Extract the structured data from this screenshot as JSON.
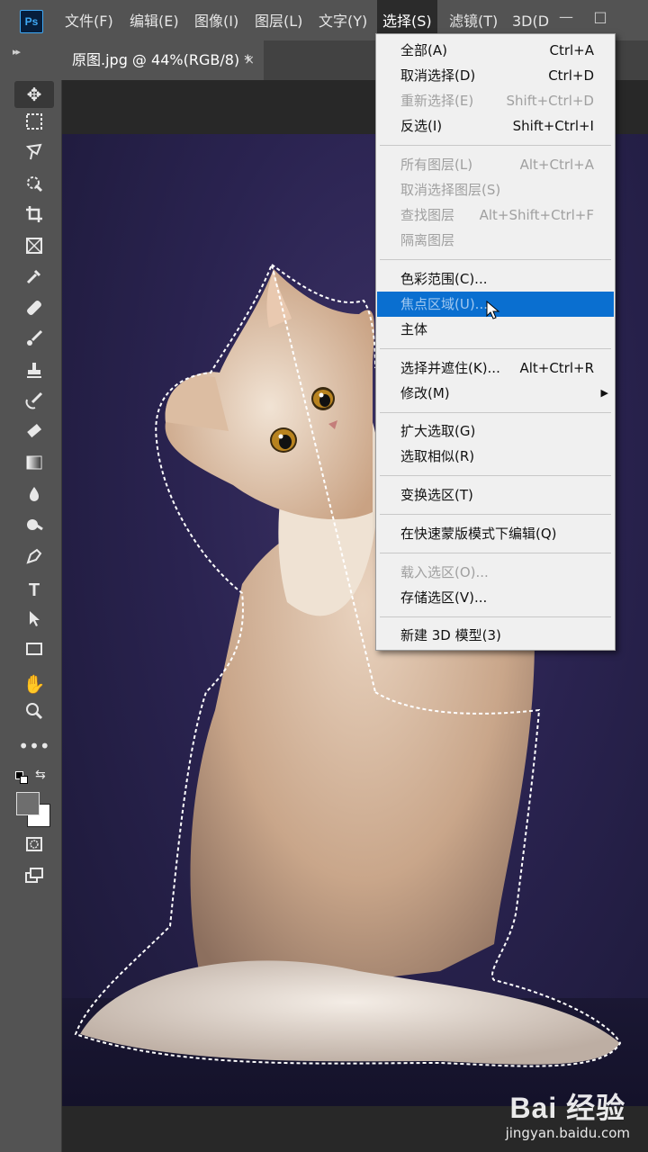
{
  "menubar": {
    "logo": "Ps",
    "items": [
      "文件(F)",
      "编辑(E)",
      "图像(I)",
      "图层(L)",
      "文字(Y)",
      "选择(S)",
      "滤镜(T)",
      "3D(D"
    ],
    "active_index": 5,
    "window_controls": [
      "—",
      "□"
    ]
  },
  "document_tab": {
    "title": "原图.jpg @ 44%(RGB/8) *",
    "close": "×"
  },
  "toolbar": {
    "tools": [
      "move-tool",
      "marquee-tool",
      "lasso-tool",
      "quick-select-tool",
      "crop-tool",
      "frame-tool",
      "eyedropper-tool",
      "healing-brush-tool",
      "brush-tool",
      "clone-stamp-tool",
      "history-brush-tool",
      "eraser-tool",
      "gradient-tool",
      "blur-tool",
      "dodge-tool",
      "pen-tool",
      "type-tool",
      "path-select-tool",
      "rectangle-tool",
      "hand-tool",
      "zoom-tool",
      "more-tools",
      "swap-colors",
      "color-swatches",
      "quick-mask",
      "screen-mode"
    ],
    "colors": {
      "foreground": "#6e6e6e",
      "background": "#ffffff"
    }
  },
  "select_menu": {
    "items": [
      {
        "label": "全部(A)",
        "shortcut": "Ctrl+A",
        "enabled": true
      },
      {
        "label": "取消选择(D)",
        "shortcut": "Ctrl+D",
        "enabled": true
      },
      {
        "label": "重新选择(E)",
        "shortcut": "Shift+Ctrl+D",
        "enabled": false
      },
      {
        "label": "反选(I)",
        "shortcut": "Shift+Ctrl+I",
        "enabled": true
      },
      {
        "label": "所有图层(L)",
        "shortcut": "Alt+Ctrl+A",
        "enabled": false
      },
      {
        "label": "取消选择图层(S)",
        "shortcut": "",
        "enabled": false
      },
      {
        "label": "查找图层",
        "shortcut": "Alt+Shift+Ctrl+F",
        "enabled": false
      },
      {
        "label": "隔离图层",
        "shortcut": "",
        "enabled": false
      },
      {
        "label": "色彩范围(C)...",
        "shortcut": "",
        "enabled": true
      },
      {
        "label": "焦点区域(U)...",
        "shortcut": "",
        "enabled": true,
        "highlighted": true
      },
      {
        "label": "主体",
        "shortcut": "",
        "enabled": true
      },
      {
        "label": "选择并遮住(K)...",
        "shortcut": "Alt+Ctrl+R",
        "enabled": true
      },
      {
        "label": "修改(M)",
        "shortcut": "",
        "enabled": true,
        "submenu": true
      },
      {
        "label": "扩大选取(G)",
        "shortcut": "",
        "enabled": true
      },
      {
        "label": "选取相似(R)",
        "shortcut": "",
        "enabled": true
      },
      {
        "label": "变换选区(T)",
        "shortcut": "",
        "enabled": true
      },
      {
        "label": "在快速蒙版模式下编辑(Q)",
        "shortcut": "",
        "enabled": true
      },
      {
        "label": "载入选区(O)...",
        "shortcut": "",
        "enabled": false
      },
      {
        "label": "存储选区(V)...",
        "shortcut": "",
        "enabled": true
      },
      {
        "label": "新建 3D 模型(3)",
        "shortcut": "",
        "enabled": true
      }
    ],
    "highlight_color": "#0a6fd0"
  },
  "watermark": {
    "brand": "Bai 经验",
    "url": "jingyan.baidu.com"
  }
}
